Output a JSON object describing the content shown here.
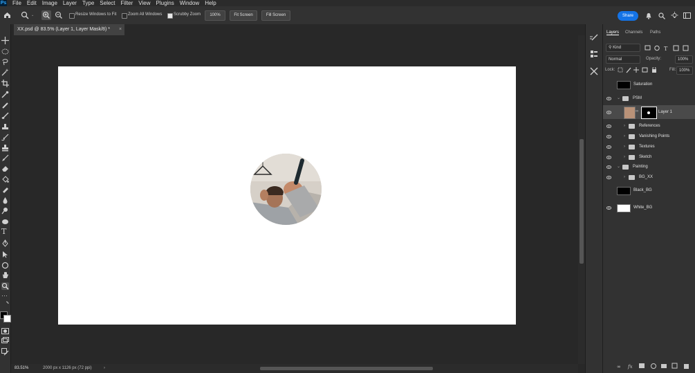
{
  "menu": [
    "File",
    "Edit",
    "Image",
    "Layer",
    "Type",
    "Select",
    "Filter",
    "View",
    "Plugins",
    "Window",
    "Help"
  ],
  "options_bar": {
    "resize_windows_label": "Resize Windows to Fit",
    "zoom_all_label": "Zoom All Windows",
    "scrubby_zoom_label": "Scrubby Zoom",
    "zoom_value": "100%",
    "fit_screen_label": "Fit Screen",
    "fill_screen_label": "Fill Screen",
    "share_label": "Share"
  },
  "document": {
    "tab_title": "XX.psd @ 83.5% (Layer 1, Layer Mask/8) *",
    "zoom_readout": "83.51%",
    "dimensions_readout": "2000 px x 1126 px (72 ppi)",
    "background_color": "#ffffff"
  },
  "layers_panel": {
    "tabs": [
      "Layers",
      "Channels",
      "Paths"
    ],
    "kind_label": "Kind",
    "blend_mode": "Normal",
    "opacity_label": "Opacity:",
    "opacity_value": "100%",
    "lock_label": "Lock:",
    "fill_label": "Fill:",
    "fill_value": "100%",
    "layers": [
      {
        "name": "Saturation",
        "type": "adjustment",
        "visible": false,
        "thumb_color": "#000000"
      },
      {
        "name": "PSM",
        "type": "group",
        "visible": true,
        "expanded": true
      },
      {
        "name": "Layer 1",
        "type": "pixel",
        "visible": true,
        "selected": true
      },
      {
        "name": "References",
        "type": "group",
        "visible": true,
        "expanded": false
      },
      {
        "name": "Vanishing Points",
        "type": "group",
        "visible": true,
        "expanded": false
      },
      {
        "name": "Textures",
        "type": "group",
        "visible": true,
        "expanded": false
      },
      {
        "name": "Sketch",
        "type": "group",
        "visible": true,
        "expanded": false
      },
      {
        "name": "Painting",
        "type": "group",
        "visible": true,
        "expanded": true
      },
      {
        "name": "BG_XX",
        "type": "group",
        "visible": true,
        "expanded": false
      },
      {
        "name": "Black_BG",
        "type": "fill",
        "visible": false,
        "thumb_color": "#000000"
      },
      {
        "name": "White_BG",
        "type": "fill",
        "visible": true,
        "thumb_color": "#ffffff"
      }
    ]
  },
  "colors": {
    "accent": "#1473e6",
    "panel_bg": "#323232",
    "app_bg": "#282828"
  }
}
